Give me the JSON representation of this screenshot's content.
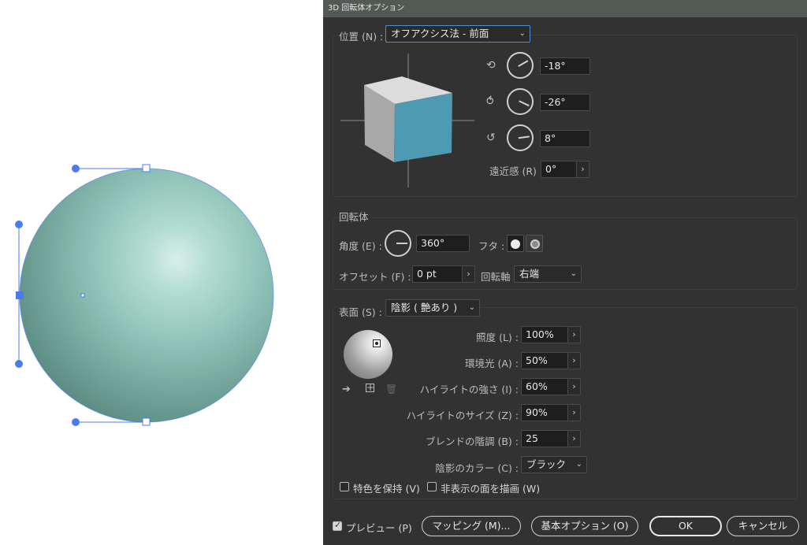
{
  "dialog": {
    "title": "3D 回転体オプション",
    "position": {
      "label": "位置 (N) :",
      "value": "オフアクシス法 - 前面",
      "x_rotation": "-18°",
      "y_rotation": "-26°",
      "z_rotation": "8°",
      "perspective_label": "遠近感 (R) :",
      "perspective_value": "0°"
    },
    "revolve": {
      "section_label": "回転体",
      "angle_label": "角度 (E) :",
      "angle_value": "360°",
      "cap_label": "フタ :",
      "offset_label": "オフセット (F) :",
      "offset_value": "0 pt",
      "from_label": "回転軸",
      "from_value": "右端"
    },
    "surface": {
      "label": "表面 (S) :",
      "value": "陰影 ( 艶あり )",
      "light_intensity_label": "照度 (L) :",
      "light_intensity_value": "100%",
      "ambient_label": "環境光 (A) :",
      "ambient_value": "50%",
      "highlight_intensity_label": "ハイライトの強さ (I) :",
      "highlight_intensity_value": "60%",
      "highlight_size_label": "ハイライトのサイズ (Z) :",
      "highlight_size_value": "90%",
      "blend_steps_label": "ブレンドの階調 (B) :",
      "blend_steps_value": "25",
      "shading_color_label": "陰影のカラー (C) :",
      "shading_color_value": "ブラック",
      "preserve_spot_label": "特色を保持 (V)",
      "draw_hidden_label": "非表示の面を描画 (W)"
    },
    "footer": {
      "preview_label": "プレビュー (P)",
      "mapping_label": "マッピング (M)...",
      "fewer_options_label": "基本オプション (O)",
      "ok_label": "OK",
      "cancel_label": "キャンセル"
    },
    "colors": {
      "cube_front": "#4f9ab3",
      "dialog_bg": "#323232",
      "selection": "#4a7cf0",
      "sphere": "#8fc0b4"
    }
  }
}
